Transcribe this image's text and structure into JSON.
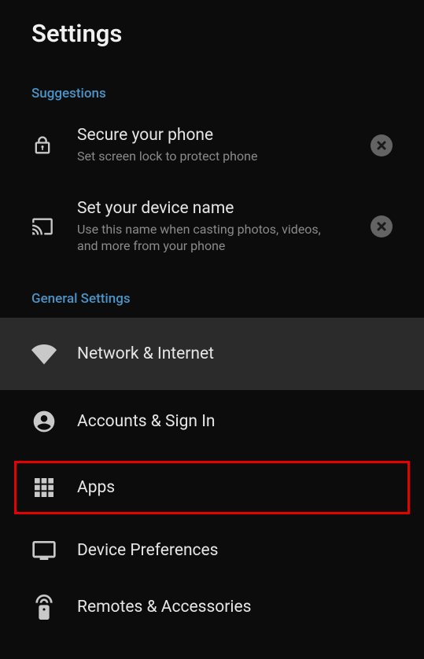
{
  "header": {
    "title": "Settings"
  },
  "sections": {
    "suggestions": {
      "label": "Suggestions",
      "items": [
        {
          "id": "secure-phone",
          "title": "Secure your phone",
          "sub": "Set screen lock to protect phone"
        },
        {
          "id": "device-name",
          "title": "Set your device name",
          "sub": "Use this name when casting photos, videos, and more from your phone"
        }
      ]
    },
    "general": {
      "label": "General Settings",
      "items": [
        {
          "id": "network",
          "title": "Network & Internet"
        },
        {
          "id": "accounts",
          "title": "Accounts & Sign In"
        },
        {
          "id": "apps",
          "title": "Apps"
        },
        {
          "id": "device-prefs",
          "title": "Device Preferences"
        },
        {
          "id": "remotes",
          "title": "Remotes & Accessories"
        }
      ]
    }
  }
}
